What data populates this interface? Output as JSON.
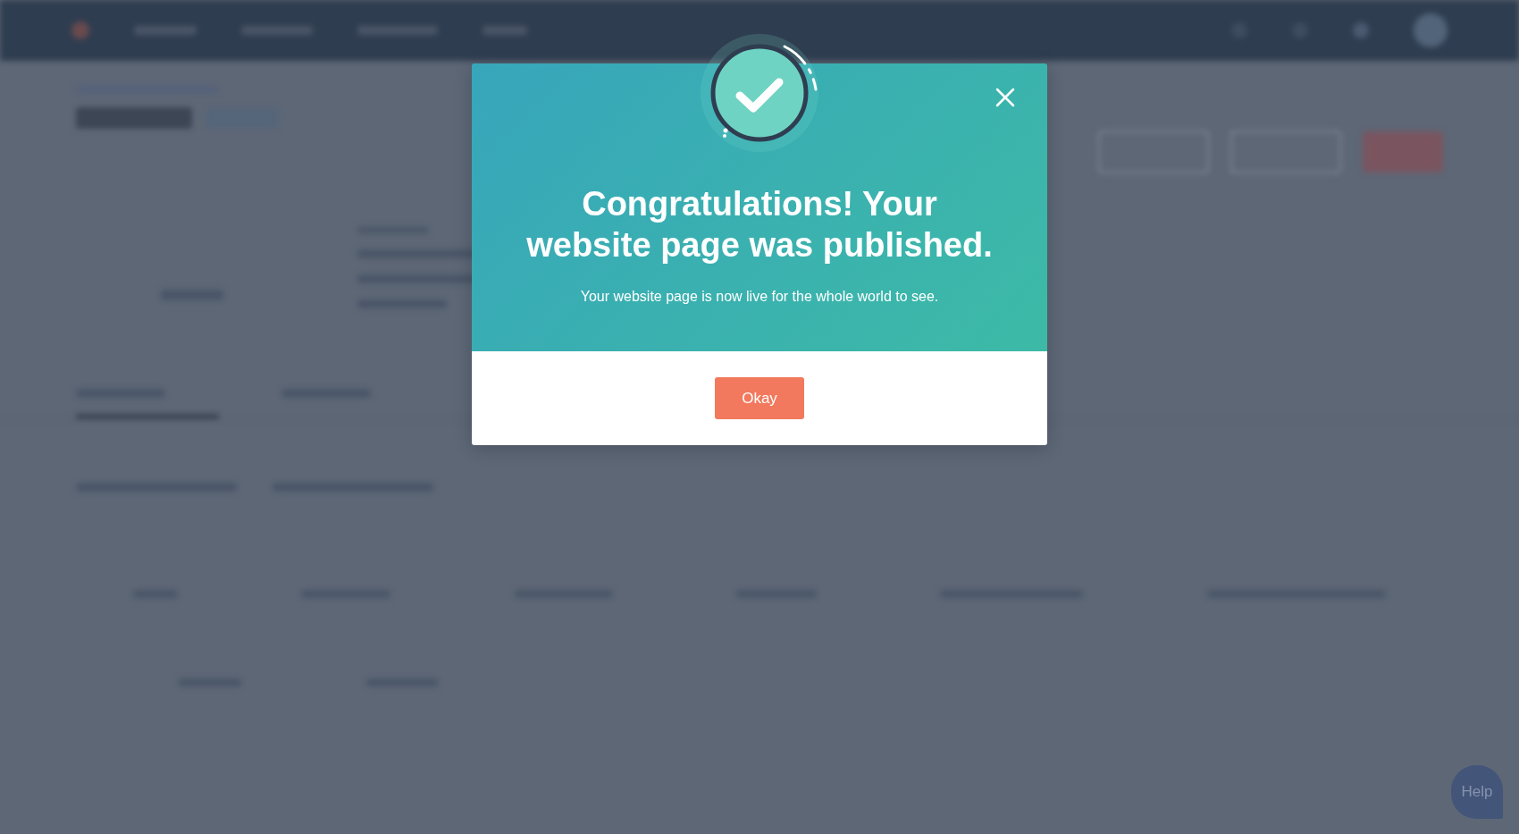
{
  "dialog": {
    "title": "Congratulations! Your website page was published.",
    "message": "Your website page is now live for the whole world to see.",
    "button": "Okay"
  },
  "help": {
    "label": "Help"
  }
}
